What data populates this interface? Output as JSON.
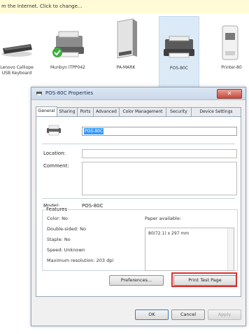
{
  "infobar": {
    "text": "m the Internet. Click to change..."
  },
  "devices": [
    {
      "label": "Lenovo Calliope\nUSB Keyboard",
      "icon": "keyboard-icon",
      "selected": false
    },
    {
      "label": "Munbyn ITPP042",
      "icon": "printer-icon",
      "selected": false
    },
    {
      "label": "PA-MARK",
      "icon": "printer-tower-icon",
      "selected": false
    },
    {
      "label": "POS-80C",
      "icon": "printer-icon",
      "selected": true
    },
    {
      "label": "Printer-80",
      "icon": "printer-icon",
      "selected": false
    }
  ],
  "dialog": {
    "title": "POS-80C Properties",
    "close": "✕",
    "tabs": [
      "General",
      "Sharing",
      "Ports",
      "Advanced",
      "Color Management",
      "Security",
      "Device Settings"
    ],
    "active_tab": "General",
    "printer_name": "POS-80C",
    "location_label": "Location:",
    "location_value": "",
    "comment_label": "Comment:",
    "comment_value": "",
    "model_label": "Model:",
    "model_value": "POS-80C",
    "features": {
      "title": "Features",
      "color": "Color: No",
      "double_sided": "Double-sided: No",
      "staple": "Staple: No",
      "speed": "Speed: Unknown",
      "max_res": "Maximum resolution: 203 dpi",
      "paper_label": "Paper available:",
      "paper_items": [
        "80(72.1) x 297 mm"
      ]
    },
    "buttons": {
      "preferences": "Preferences...",
      "print_test": "Print Test Page",
      "ok": "OK",
      "cancel": "Cancel",
      "apply": "Apply"
    }
  },
  "colors": {
    "highlight": "#d9322f",
    "selection": "#3399ff"
  }
}
